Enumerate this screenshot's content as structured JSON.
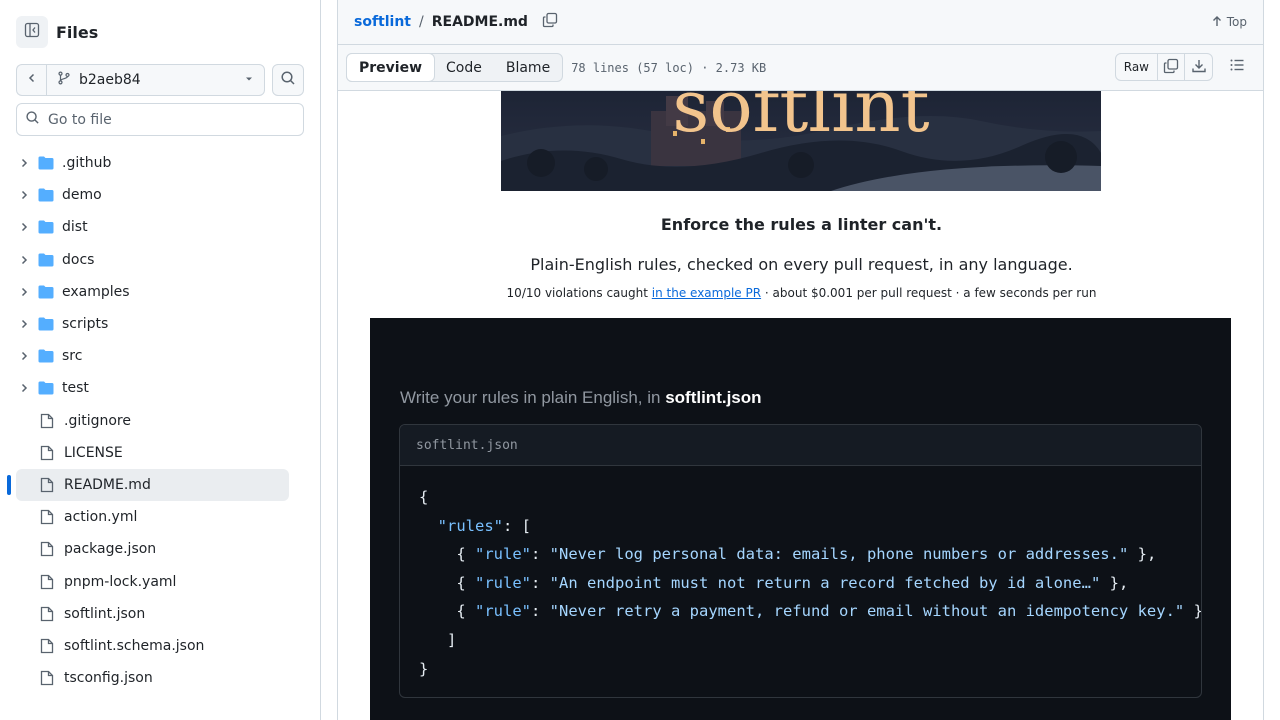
{
  "sidebar": {
    "title": "Files",
    "branch": "b2aeb84",
    "goto_placeholder": "Go to file",
    "folders": [
      ".github",
      "demo",
      "dist",
      "docs",
      "examples",
      "scripts",
      "src",
      "test"
    ],
    "files": [
      ".gitignore",
      "LICENSE",
      "README.md",
      "action.yml",
      "package.json",
      "pnpm-lock.yaml",
      "softlint.json",
      "softlint.schema.json",
      "tsconfig.json"
    ],
    "active_file": "README.md"
  },
  "header": {
    "repo": "softlint",
    "separator": "/",
    "file": "README.md",
    "top_label": "Top"
  },
  "toolbar": {
    "tabs": [
      "Preview",
      "Code",
      "Blame"
    ],
    "active_tab": "Preview",
    "meta": "78 lines (57 loc) · 2.73 KB",
    "raw_label": "Raw"
  },
  "readme": {
    "banner_text": "softlint",
    "tagline": "Enforce the rules a linter can't.",
    "subline": "Plain-English rules, checked on every pull request, in any language.",
    "stat_prefix": "10/10 violations caught ",
    "stat_link": "in the example PR",
    "stat_suffix": " · about $0.001 per pull request · a few seconds per run",
    "demo_caption_prefix": "Write your rules in plain English, in ",
    "demo_caption_file": "softlint.json",
    "code_filename": "softlint.json",
    "rules": [
      "Never log personal data: emails, phone numbers or addresses.",
      "An endpoint must not return a record fetched by id alone…",
      "Never retry a payment, refund or email without an idempotency key."
    ]
  },
  "colors": {
    "accent": "#0969da",
    "code_bg": "#0d1117",
    "code_key": "#79c0ff",
    "code_string": "#a5d6ff"
  }
}
